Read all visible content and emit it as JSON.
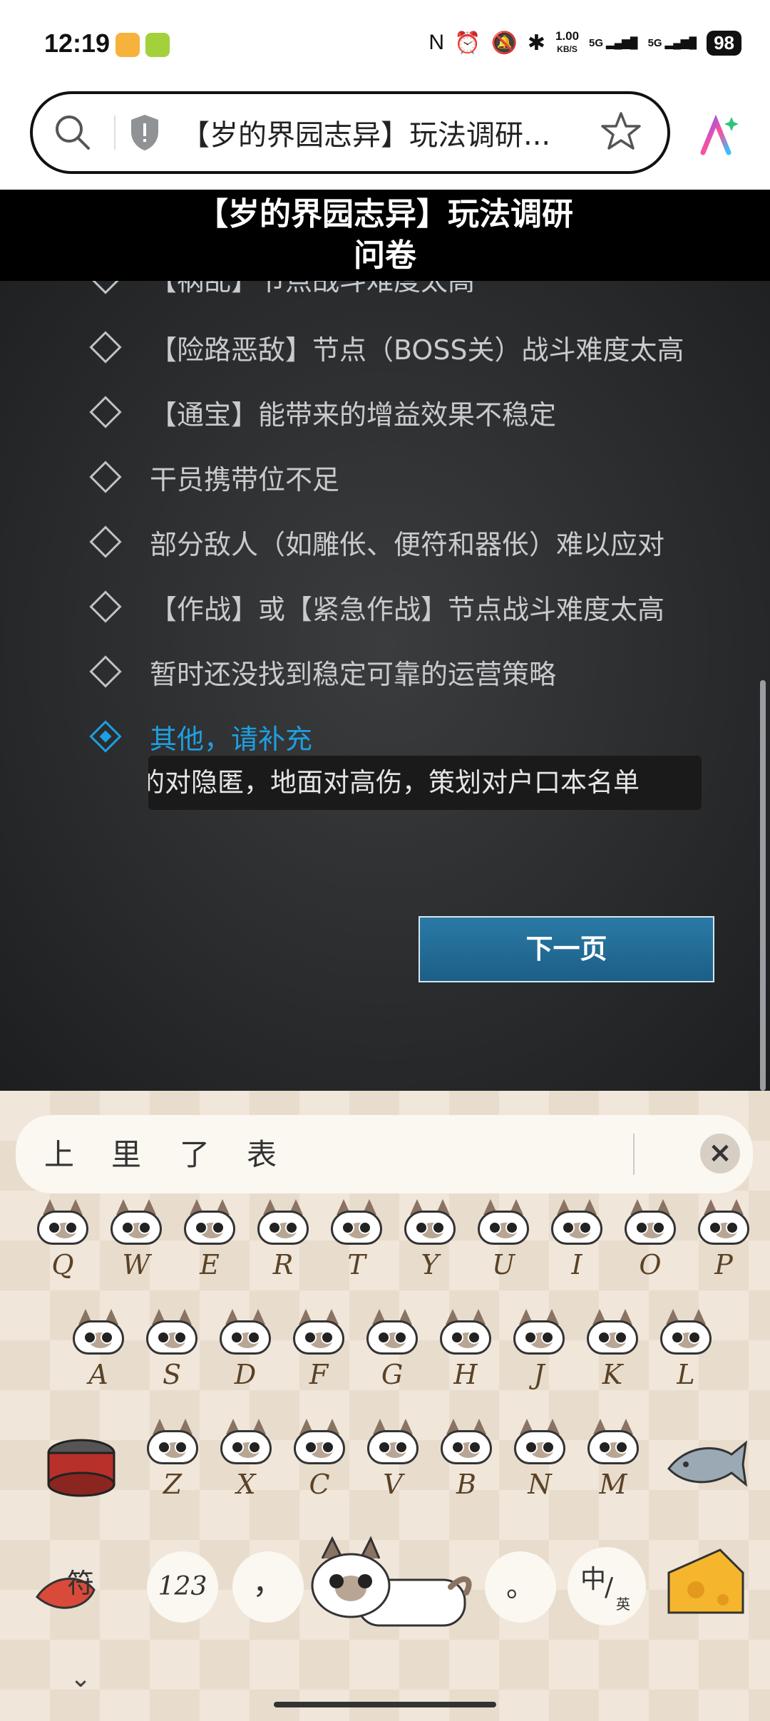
{
  "status_bar": {
    "time": "12:19",
    "net_speed_value": "1.00",
    "net_speed_unit": "KB/S",
    "signal1": "5G",
    "signal2": "5G",
    "battery": "98"
  },
  "address_bar": {
    "url_text": "【岁的界园志异】玩法调研..."
  },
  "page": {
    "title": "【岁的界园志异】玩法调研问卷",
    "options": [
      {
        "label": "【祸乱】节点战斗难度太高",
        "selected": false
      },
      {
        "label": "【险路恶敌】节点（BOSS关）战斗难度太高",
        "selected": false
      },
      {
        "label": "【通宝】能带来的增益效果不稳定",
        "selected": false
      },
      {
        "label": "干员携带位不足",
        "selected": false
      },
      {
        "label": "部分敌人（如雕伥、便符和器伥）难以应对",
        "selected": false
      },
      {
        "label": "【作战】或【紧急作战】节点战斗难度太高",
        "selected": false
      },
      {
        "label": "暂时还没找到稳定可靠的运营策略",
        "selected": false
      },
      {
        "label": "其他，请补充",
        "selected": true
      }
    ],
    "other_input_value": "的对隐匿，地面对高伤，策划对户口本名单",
    "next_button": "下一页"
  },
  "keyboard": {
    "candidates": [
      "上",
      "里",
      "了",
      "表"
    ],
    "close": "×",
    "row1": [
      "Q",
      "W",
      "E",
      "R",
      "T",
      "Y",
      "U",
      "I",
      "O",
      "P"
    ],
    "row2": [
      "A",
      "S",
      "D",
      "F",
      "G",
      "H",
      "J",
      "K",
      "L"
    ],
    "row3": [
      "Z",
      "X",
      "C",
      "V",
      "B",
      "N",
      "M"
    ],
    "symbol_key": "符",
    "num_key": "123",
    "comma_key": "，",
    "period_key": "。",
    "lang_key_main": "中",
    "lang_key_sub": "英",
    "collapse": "⌄"
  }
}
